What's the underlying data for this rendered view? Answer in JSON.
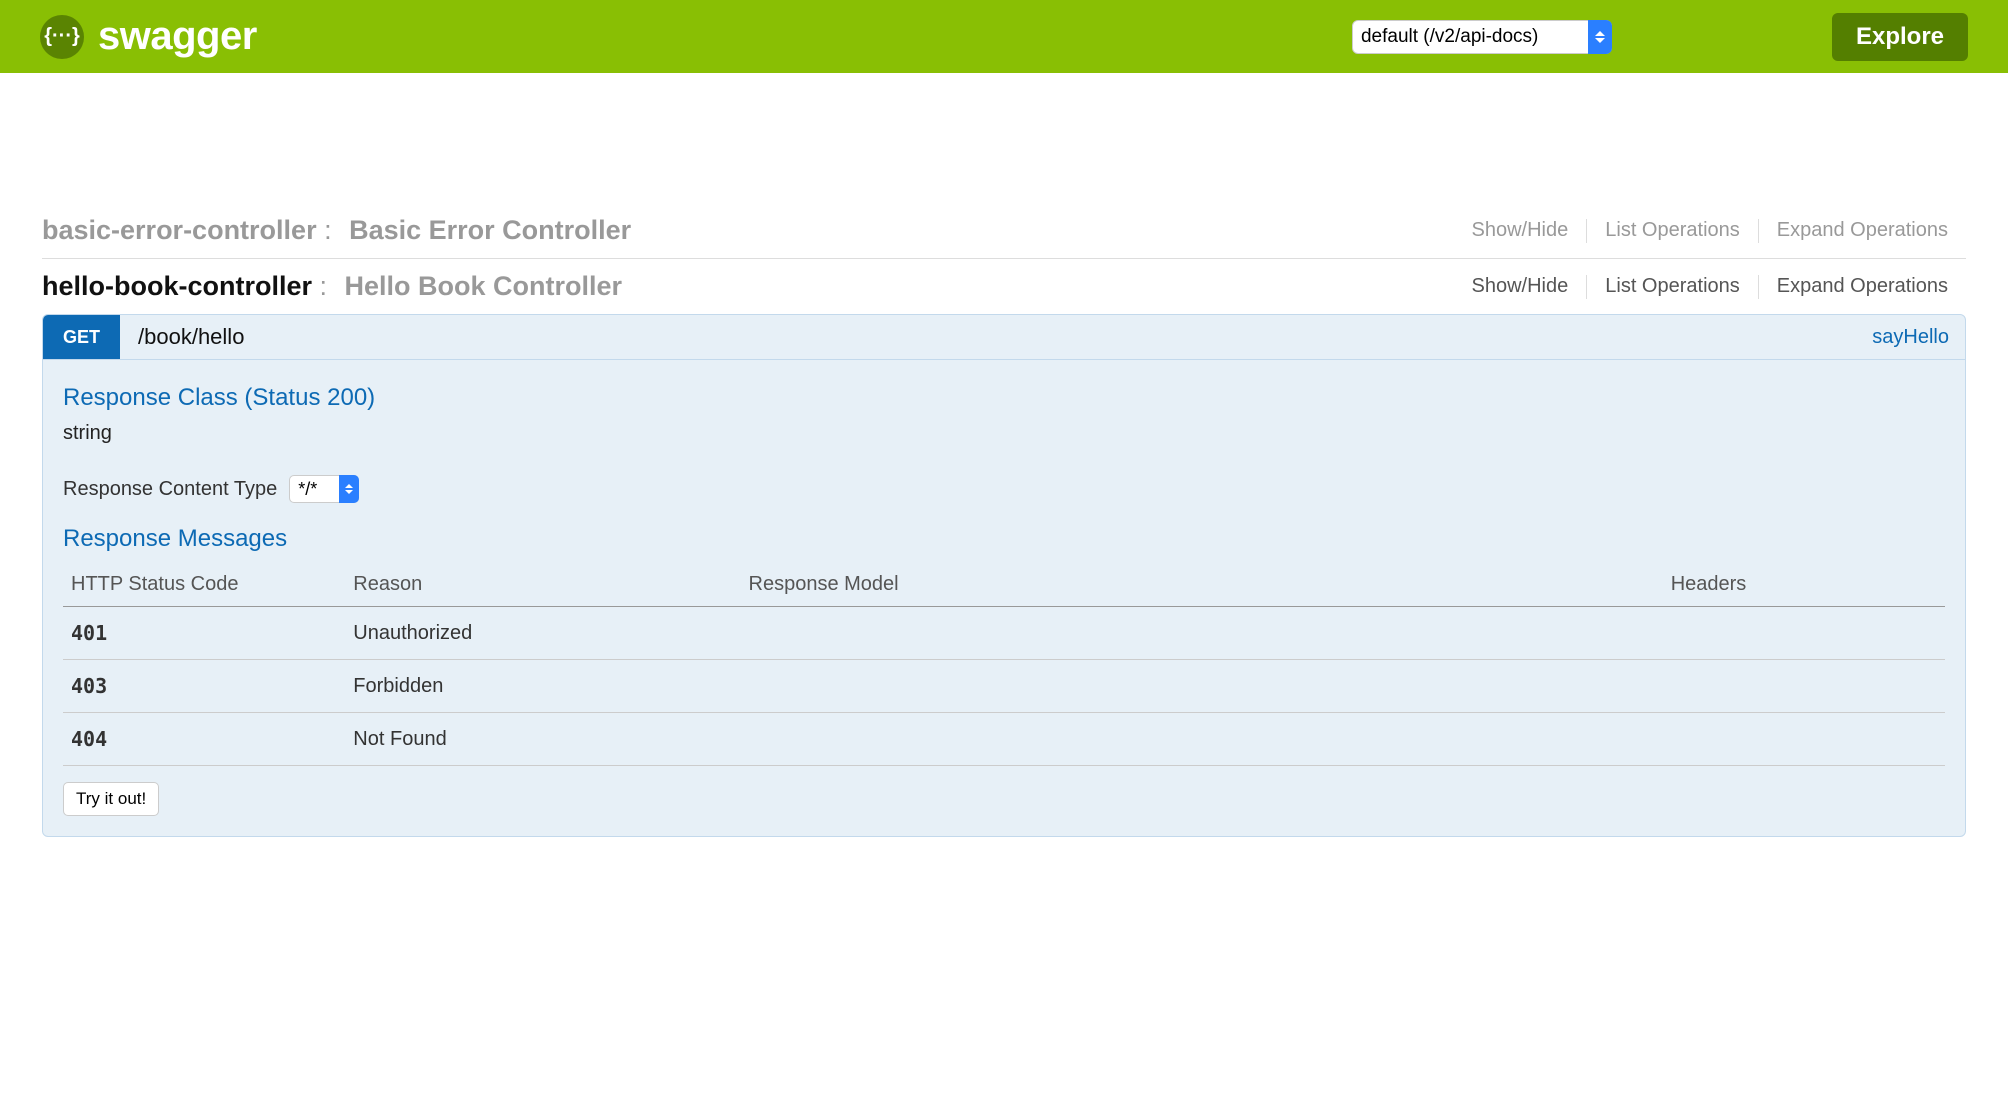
{
  "header": {
    "logo_text": "swagger",
    "api_select": "default (/v2/api-docs)",
    "explore_label": "Explore"
  },
  "controllers": [
    {
      "id": "basic-error-controller",
      "desc": "Basic Error Controller",
      "active": false,
      "actions": {
        "show_hide": "Show/Hide",
        "list_ops": "List Operations",
        "expand_ops": "Expand Operations"
      }
    },
    {
      "id": "hello-book-controller",
      "desc": "Hello Book Controller",
      "active": true,
      "actions": {
        "show_hide": "Show/Hide",
        "list_ops": "List Operations",
        "expand_ops": "Expand Operations"
      }
    }
  ],
  "operation": {
    "method": "GET",
    "path": "/book/hello",
    "nickname": "sayHello",
    "response_class_heading": "Response Class (Status 200)",
    "response_type": "string",
    "content_type_label": "Response Content Type",
    "content_type_value": "*/*",
    "response_messages_heading": "Response Messages",
    "table_headers": {
      "code": "HTTP Status Code",
      "reason": "Reason",
      "model": "Response Model",
      "headers": "Headers"
    },
    "responses": [
      {
        "code": "401",
        "reason": "Unauthorized"
      },
      {
        "code": "403",
        "reason": "Forbidden"
      },
      {
        "code": "404",
        "reason": "Not Found"
      }
    ],
    "try_label": "Try it out!"
  }
}
